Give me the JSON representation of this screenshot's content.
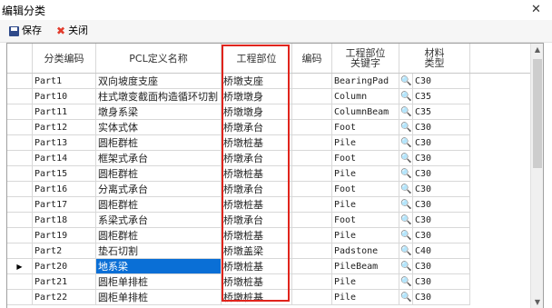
{
  "window": {
    "title": "编辑分类",
    "close_glyph": "✕"
  },
  "toolbar": {
    "save_label": "保存",
    "close_label": "关闭"
  },
  "columns": [
    "分类编码",
    "PCL定义名称",
    "工程部位",
    "编码",
    "工程部位\n关键字",
    "材料\n类型"
  ],
  "rows": [
    {
      "code": "Part1",
      "name": "双向坡度支座",
      "part": "桥墩支座",
      "enc": "",
      "key": "BearingPad",
      "mat": "C30"
    },
    {
      "code": "Part10",
      "name": "柱式墩变截面构造循环切割",
      "part": "桥墩墩身",
      "enc": "",
      "key": "Column",
      "mat": "C35"
    },
    {
      "code": "Part11",
      "name": "墩身系梁",
      "part": "桥墩墩身",
      "enc": "",
      "key": "ColumnBeam",
      "mat": "C35"
    },
    {
      "code": "Part12",
      "name": "实体式体",
      "part": "桥墩承台",
      "enc": "",
      "key": "Foot",
      "mat": "C30"
    },
    {
      "code": "Part13",
      "name": "圆柜群桩",
      "part": "桥墩桩基",
      "enc": "",
      "key": "Pile",
      "mat": "C30"
    },
    {
      "code": "Part14",
      "name": "框架式承台",
      "part": "桥墩承台",
      "enc": "",
      "key": "Foot",
      "mat": "C30"
    },
    {
      "code": "Part15",
      "name": "圆柜群桩",
      "part": "桥墩桩基",
      "enc": "",
      "key": "Pile",
      "mat": "C30"
    },
    {
      "code": "Part16",
      "name": "分离式承台",
      "part": "桥墩承台",
      "enc": "",
      "key": "Foot",
      "mat": "C30"
    },
    {
      "code": "Part17",
      "name": "圆柜群桩",
      "part": "桥墩桩基",
      "enc": "",
      "key": "Pile",
      "mat": "C30"
    },
    {
      "code": "Part18",
      "name": "系梁式承台",
      "part": "桥墩承台",
      "enc": "",
      "key": "Foot",
      "mat": "C30"
    },
    {
      "code": "Part19",
      "name": "圆柜群桩",
      "part": "桥墩桩基",
      "enc": "",
      "key": "Pile",
      "mat": "C30"
    },
    {
      "code": "Part2",
      "name": "垫石切割",
      "part": "桥墩盖梁",
      "enc": "",
      "key": "Padstone",
      "mat": "C40"
    },
    {
      "code": "Part20",
      "name": "地系梁",
      "part": "桥墩桩基",
      "enc": "",
      "key": "PileBeam",
      "mat": "C30",
      "selected": true
    },
    {
      "code": "Part21",
      "name": "圆柜单排桩",
      "part": "桥墩桩基",
      "enc": "",
      "key": "Pile",
      "mat": "C30"
    },
    {
      "code": "Part22",
      "name": "圆柜单排桩",
      "part": "桥墩桩基",
      "enc": "",
      "key": "Pile",
      "mat": "C30"
    }
  ],
  "row_indicator": "▶",
  "magnifier_glyph": "🔍",
  "scroll": {
    "up_glyph": "▲",
    "down_glyph": "▼"
  },
  "highlight_color": "#e0241c"
}
